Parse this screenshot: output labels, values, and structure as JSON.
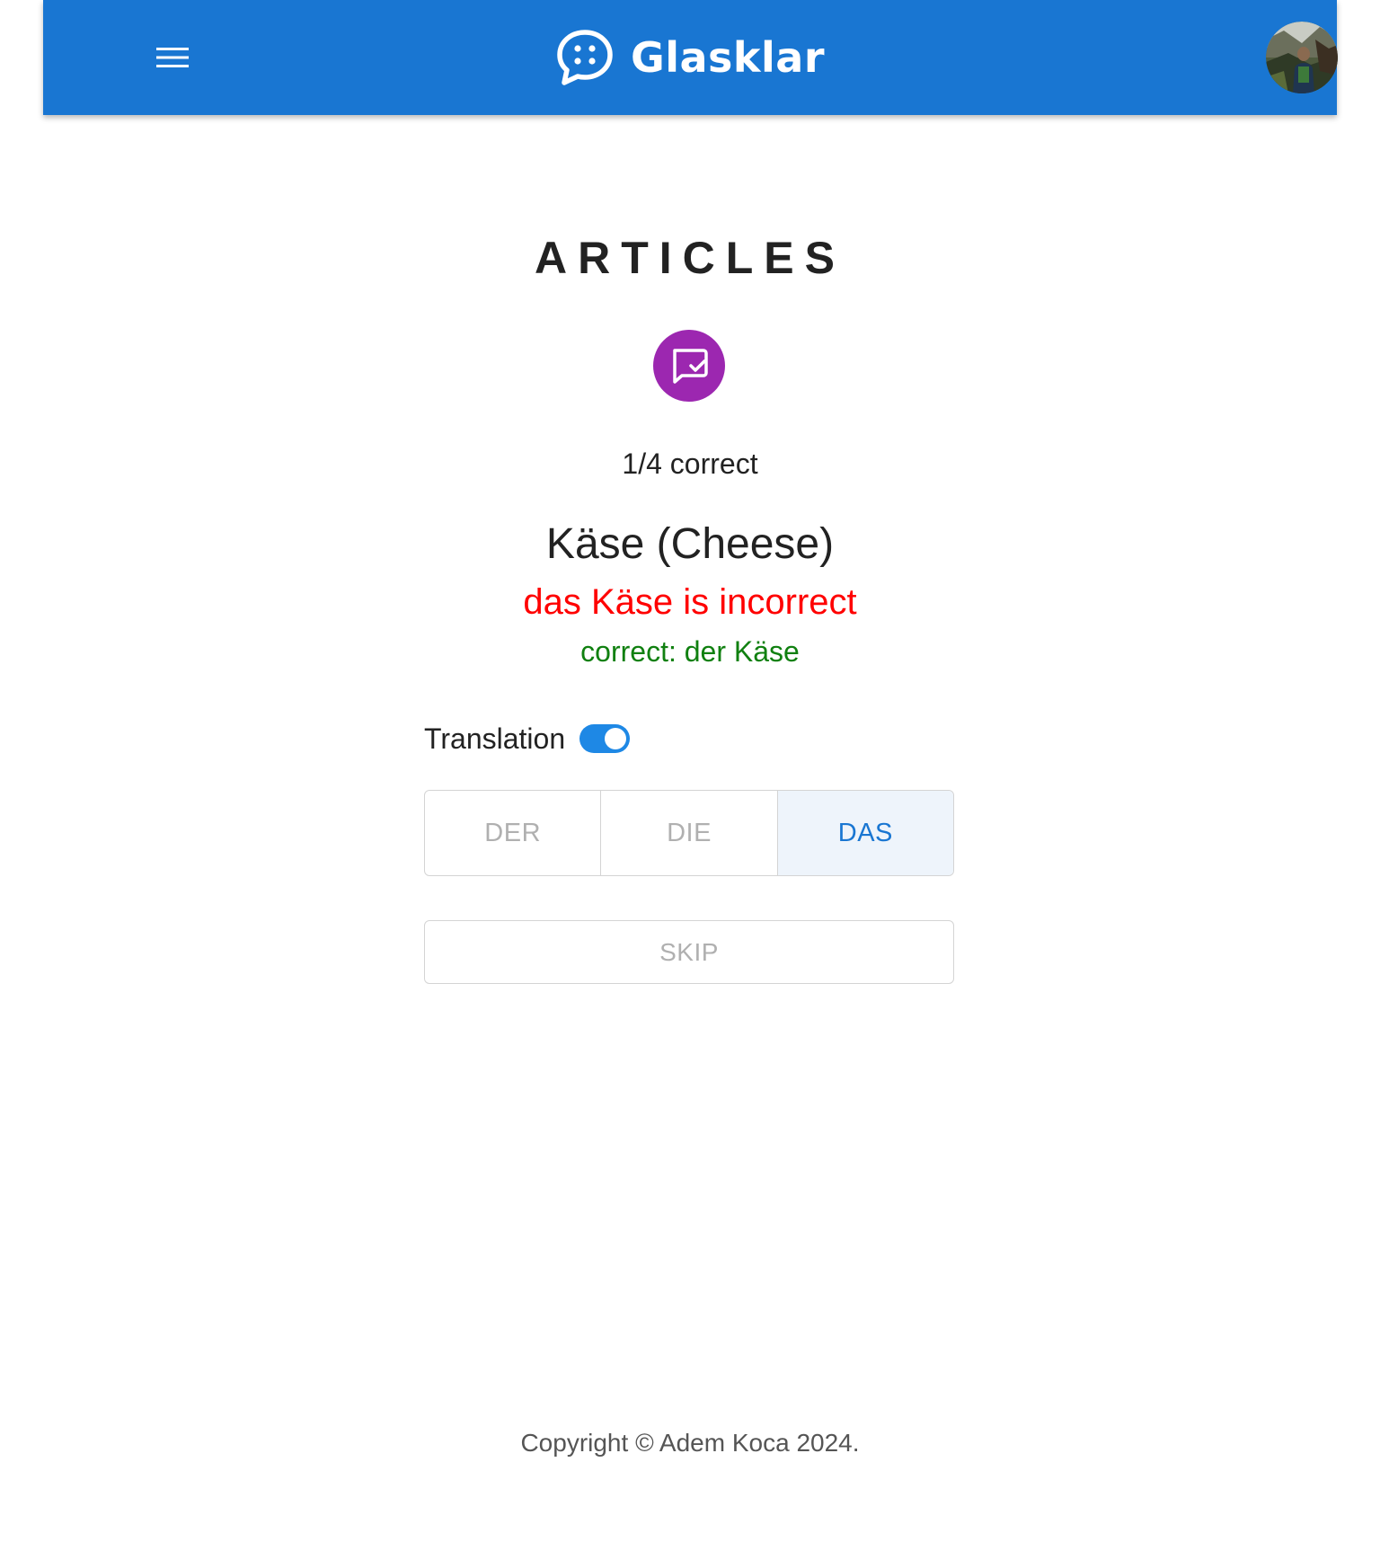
{
  "header": {
    "brand_name": "Glasklar",
    "brand_icon": "chat-bubble-dots-icon",
    "menu_icon": "hamburger-menu-icon",
    "avatar": "user-avatar-photo",
    "bar_color": "#1976d2"
  },
  "main": {
    "title": "ARTICLES",
    "quiz_icon": "quiz-check-bubble-icon",
    "quiz_icon_color": "#9c27b0",
    "score_text": "1/4 correct",
    "word": "Käse (Cheese)",
    "feedback_incorrect": "das Käse is incorrect",
    "feedback_correct": "correct: der Käse",
    "incorrect_color": "#ff0000",
    "correct_color": "#108010",
    "translation_label": "Translation",
    "translation_enabled": true,
    "options": [
      {
        "label": "DER",
        "selected": false
      },
      {
        "label": "DIE",
        "selected": false
      },
      {
        "label": "DAS",
        "selected": true
      }
    ],
    "skip_label": "SKIP"
  },
  "footer": {
    "copyright": "Copyright © Adem Koca 2024."
  }
}
